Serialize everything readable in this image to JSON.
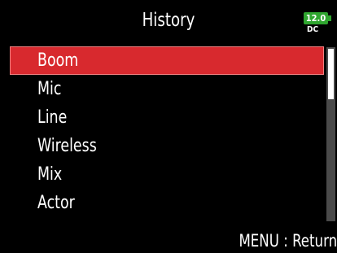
{
  "header": {
    "title": "History",
    "battery": {
      "level_text": "12.0",
      "source_text": "DC",
      "color": "#2fa52f"
    }
  },
  "list": {
    "selected_index": 0,
    "selected_color": "#d8292e",
    "items": [
      {
        "label": "Boom"
      },
      {
        "label": "Mic"
      },
      {
        "label": "Line"
      },
      {
        "label": "Wireless"
      },
      {
        "label": "Mix"
      },
      {
        "label": "Actor"
      }
    ]
  },
  "scrollbar": {
    "visible_fraction": 0.29,
    "position_fraction": 0.0
  },
  "footer": {
    "hint": "MENU : Return"
  }
}
